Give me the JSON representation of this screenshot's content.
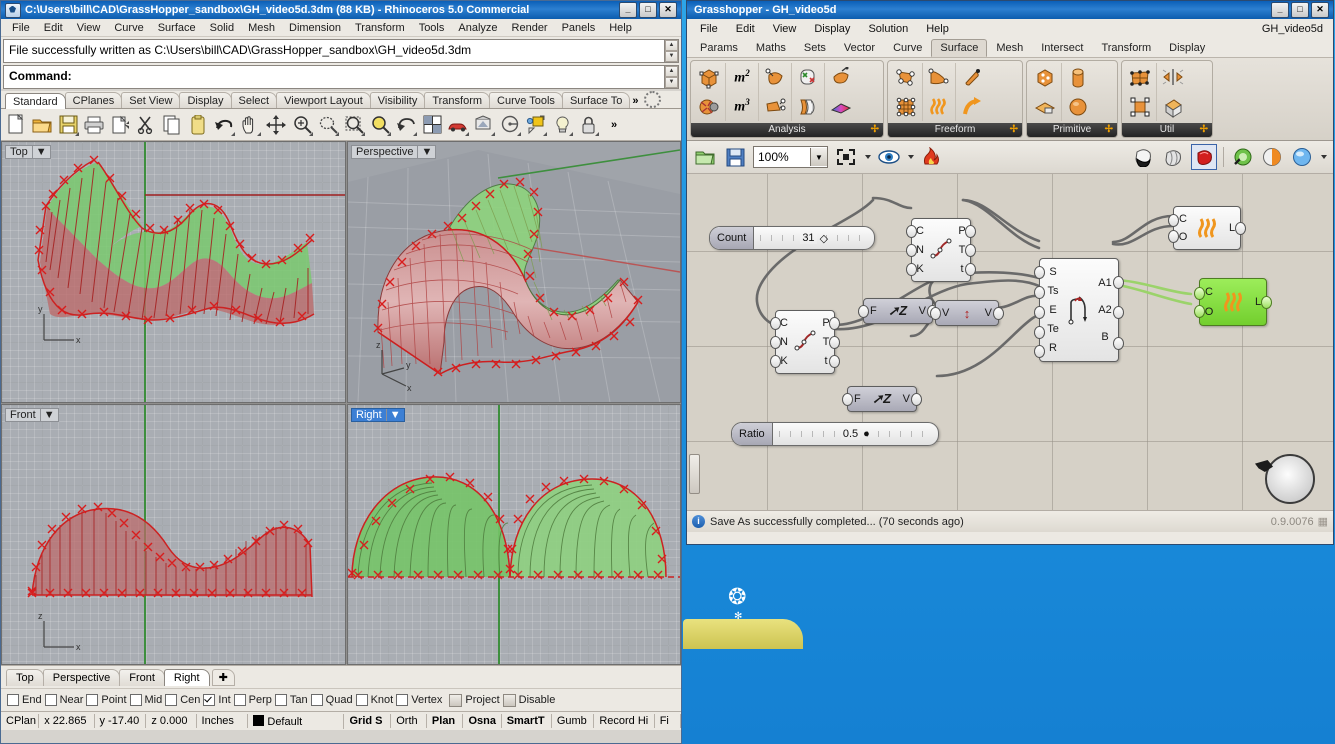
{
  "rhino": {
    "title": "C:\\Users\\bill\\CAD\\GrassHopper_sandbox\\GH_video5d.3dm (88 KB) - Rhinoceros 5.0 Commercial",
    "window_buttons": [
      "_",
      "□",
      "✕"
    ],
    "menu": [
      "File",
      "Edit",
      "View",
      "Curve",
      "Surface",
      "Solid",
      "Mesh",
      "Dimension",
      "Transform",
      "Tools",
      "Analyze",
      "Render",
      "Panels",
      "Help"
    ],
    "command_history": "File successfully written as C:\\Users\\bill\\CAD\\GrassHopper_sandbox\\GH_video5d.3dm",
    "command_prompt": "Command:",
    "toolbar_tabs": [
      "Standard",
      "CPlanes",
      "Set View",
      "Display",
      "Select",
      "Viewport Layout",
      "Visibility",
      "Transform",
      "Curve Tools",
      "Surface To"
    ],
    "toolbar_tabs_more": "»",
    "active_toolbar_tab": "Standard",
    "toolbar_icons": [
      "new-file-icon",
      "open-folder-icon",
      "save-icon",
      "print-icon",
      "copy-to-clipboard-icon",
      "cut-icon",
      "copy-icon",
      "paste-icon",
      "undo-icon",
      "pan-icon",
      "move-icon",
      "zoom-in-out-icon",
      "zoom-window-icon",
      "zoom-selected-icon",
      "zoom-extents-icon",
      "rotate-view-icon",
      "four-view-icon",
      "render-icon",
      "shade-icon",
      "properties-icon",
      "layers-icon",
      "light-icon",
      "lock-icon"
    ],
    "toolbar_overflow": "»",
    "viewports": [
      {
        "name": "Top",
        "active": false
      },
      {
        "name": "Perspective",
        "active": false
      },
      {
        "name": "Front",
        "active": false
      },
      {
        "name": "Right",
        "active": true
      }
    ],
    "view_tabs": [
      "Top",
      "Perspective",
      "Front",
      "Right"
    ],
    "active_view_tab": "Right",
    "view_tab_add": "✚",
    "osnap": [
      {
        "label": "End",
        "checked": false
      },
      {
        "label": "Near",
        "checked": false
      },
      {
        "label": "Point",
        "checked": false
      },
      {
        "label": "Mid",
        "checked": false
      },
      {
        "label": "Cen",
        "checked": false
      },
      {
        "label": "Int",
        "checked": true
      },
      {
        "label": "Perp",
        "checked": false
      },
      {
        "label": "Tan",
        "checked": false
      },
      {
        "label": "Quad",
        "checked": false
      },
      {
        "label": "Knot",
        "checked": false
      },
      {
        "label": "Vertex",
        "checked": false
      }
    ],
    "osnap_buttons": [
      "Project",
      "Disable"
    ],
    "status": {
      "cplane": "CPlan",
      "x": "x 22.865",
      "y": "y -17.40",
      "z": "z 0.000",
      "units": "Inches",
      "layer": "Default",
      "toggles": [
        "Grid S",
        "Orth",
        "Plan",
        "Osna",
        "SmartT",
        "Gumb",
        "Record Hi",
        "Fi"
      ],
      "toggles_bold": [
        true,
        false,
        true,
        true,
        true,
        false,
        false,
        false
      ]
    }
  },
  "grasshopper": {
    "title": "Grasshopper - GH_video5d",
    "window_buttons": [
      "_",
      "□",
      "✕"
    ],
    "menu": [
      "File",
      "Edit",
      "View",
      "Display",
      "Solution",
      "Help"
    ],
    "document_name": "GH_video5d",
    "categories": [
      "Params",
      "Maths",
      "Sets",
      "Vector",
      "Curve",
      "Surface",
      "Mesh",
      "Intersect",
      "Transform",
      "Display"
    ],
    "active_category": "Surface",
    "ribbon_groups": [
      {
        "name": "Analysis",
        "expand": "✢",
        "icons": [
          "box-corners-icon",
          "brep-wireframe-icon",
          "area-m2-icon",
          "volume-m3-icon",
          "evaluate-surface-icon",
          "surface-points-icon",
          "is-planar-icon",
          "deconstruct-brep-icon",
          "surface-closest-point-icon",
          "surface-curvature-icon"
        ]
      },
      {
        "name": "Freeform",
        "expand": "✢",
        "icons": [
          "4point-surface-icon",
          "control-point-loft-icon",
          "edge-surface-icon",
          "ruled-surface-icon",
          "pipe-icon",
          "revolution-icon",
          "sweep1-icon",
          "extrude-icon"
        ]
      },
      {
        "name": "Primitive",
        "expand": "✢",
        "icons": [
          "bounding-box-icon",
          "cylinder-icon",
          "plane-surface-icon",
          "sphere-icon"
        ]
      },
      {
        "name": "Util",
        "expand": "✢",
        "icons": [
          "surface-from-points-icon",
          "merge-faces-icon",
          "offset-surface-icon",
          "cap-holes-icon"
        ]
      }
    ],
    "canvas_toolbar": {
      "open_icon": "open-file-icon",
      "save_icon": "save-file-icon",
      "zoom_value": "100%",
      "zoom_dropdown": "▼",
      "zoom_extents_icon": "zoom-extents-icon",
      "preview_eye_icon": "preview-eye-icon",
      "bake_icon": "bake-icon",
      "preview_off_icon": "preview-off-icon",
      "preview_wireframe_icon": "preview-wireframe-icon",
      "preview_shaded_icon": "preview-shaded-icon",
      "sketch_icon": "sketch-green-icon",
      "widget_icon": "widget-orange-icon",
      "profiler_icon": "profiler-blue-icon"
    },
    "canvas": {
      "sliders": [
        {
          "id": "count",
          "label": "Count",
          "value": "31"
        },
        {
          "id": "ratio",
          "label": "Ratio",
          "value": "0.5"
        }
      ],
      "components": [
        {
          "id": "interp1",
          "kind": "white",
          "icon": "interpolate-curve-icon",
          "inputs": [
            "C",
            "N",
            "K"
          ],
          "outputs": [
            "P",
            "T",
            "t"
          ]
        },
        {
          "id": "interp2",
          "kind": "white",
          "icon": "interpolate-curve-icon",
          "inputs": [
            "C",
            "N",
            "K"
          ],
          "outputs": [
            "P",
            "T",
            "t"
          ]
        },
        {
          "id": "unitz1",
          "kind": "gray",
          "icon": "unit-z-icon",
          "inputs": [
            "F"
          ],
          "outputs": [
            "V"
          ],
          "label": "Z"
        },
        {
          "id": "unitz2",
          "kind": "gray",
          "icon": "unit-z-icon",
          "inputs": [
            "F"
          ],
          "outputs": [
            "V"
          ],
          "label": "Z"
        },
        {
          "id": "amplitude",
          "kind": "gray",
          "icon": "amplitude-icon",
          "inputs": [
            "V"
          ],
          "outputs": [
            "V"
          ]
        },
        {
          "id": "sweep2",
          "kind": "white",
          "icon": "sweep2-icon",
          "inputs": [
            "S",
            "Ts",
            "E",
            "Te",
            "R"
          ],
          "outputs": [
            "A1",
            "A2",
            "B"
          ]
        },
        {
          "id": "loft1",
          "kind": "white",
          "icon": "loft-icon",
          "inputs": [
            "C",
            "O"
          ],
          "outputs": [
            "L"
          ]
        },
        {
          "id": "loft2",
          "kind": "green",
          "icon": "loft-icon",
          "inputs": [
            "C",
            "O"
          ],
          "outputs": [
            "L"
          ]
        }
      ]
    },
    "status": {
      "icon": "info-icon",
      "message": "Save As successfully completed... (70 seconds ago)",
      "version": "0.9.0076"
    },
    "compass_icon": "canvas-compass-icon"
  },
  "colors": {
    "titlebar_blue": "#0b5fb8",
    "accent_orange": "#f0a000",
    "selected_green": "#73cf2e",
    "wire_gray": "#6a6a6a",
    "wire_green": "#9bd36a",
    "desktop_blue": "#1a8fe0"
  }
}
